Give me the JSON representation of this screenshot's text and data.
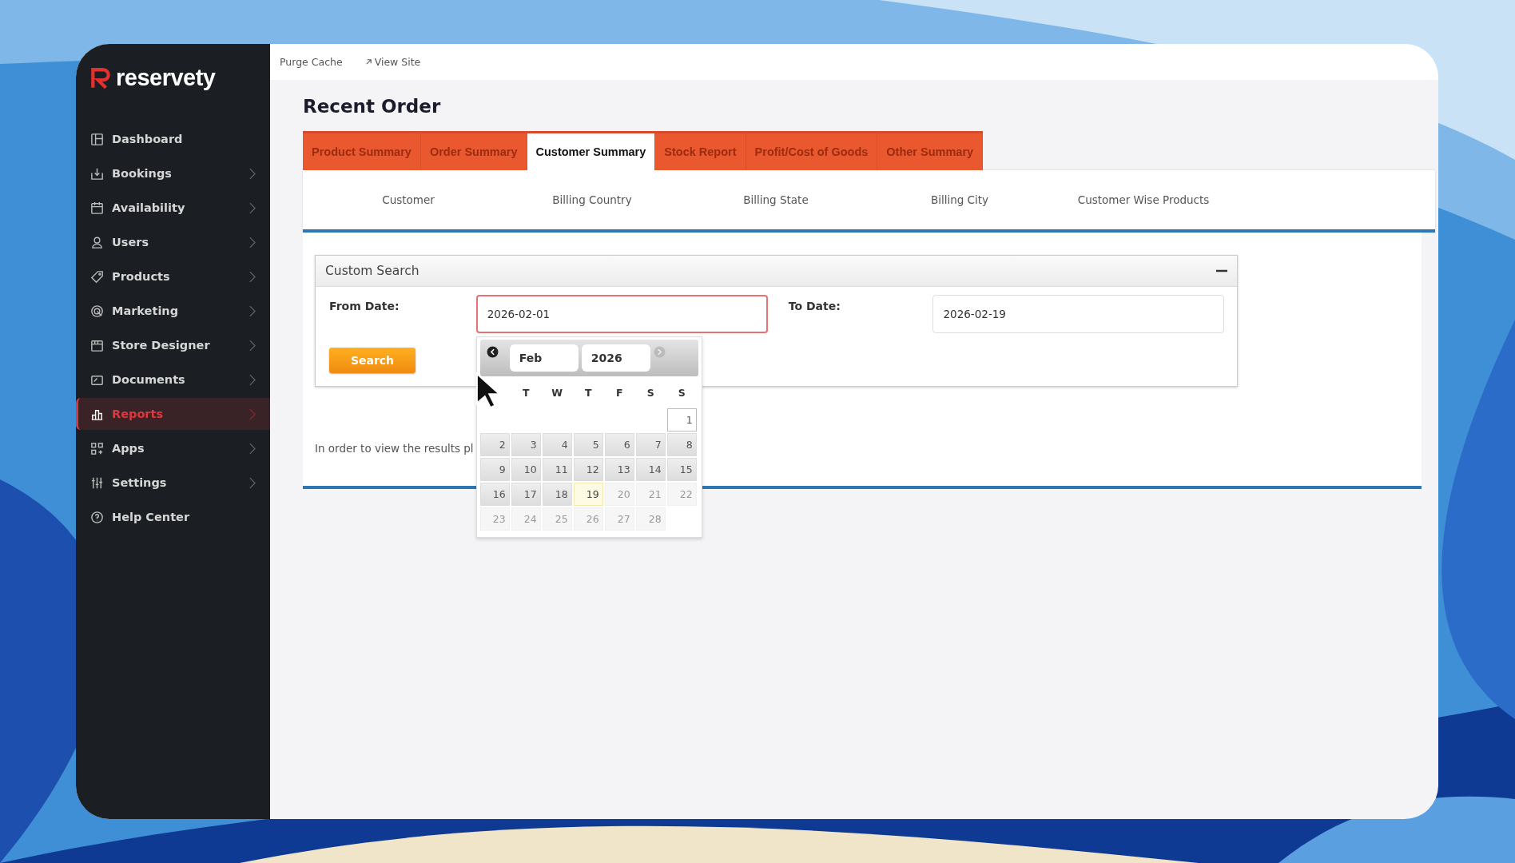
{
  "sidebar": {
    "logo": "reservety",
    "items": [
      {
        "label": "Dashboard",
        "selected": false,
        "expandable": false
      },
      {
        "label": "Bookings",
        "selected": false,
        "expandable": true
      },
      {
        "label": "Availability",
        "selected": false,
        "expandable": true
      },
      {
        "label": "Users",
        "selected": false,
        "expandable": true
      },
      {
        "label": "Products",
        "selected": false,
        "expandable": true
      },
      {
        "label": "Marketing",
        "selected": false,
        "expandable": true
      },
      {
        "label": "Store Designer",
        "selected": false,
        "expandable": true
      },
      {
        "label": "Documents",
        "selected": false,
        "expandable": true
      },
      {
        "label": "Reports",
        "selected": true,
        "expandable": true
      },
      {
        "label": "Apps",
        "selected": false,
        "expandable": true
      },
      {
        "label": "Settings",
        "selected": false,
        "expandable": true
      },
      {
        "label": "Help Center",
        "selected": false,
        "expandable": false
      }
    ]
  },
  "topbar": {
    "links": [
      {
        "label": "Purge Cache",
        "external": false
      },
      {
        "label": "View Site",
        "external": true
      }
    ]
  },
  "page_title": "Recent Order",
  "tabs": [
    {
      "label": "Product Summary",
      "selected": false
    },
    {
      "label": "Order Summary",
      "selected": false
    },
    {
      "label": "Customer Summary",
      "selected": true
    },
    {
      "label": "Stock Report",
      "selected": false
    },
    {
      "label": "Profit/Cost of Goods",
      "selected": false
    },
    {
      "label": "Other Summary",
      "selected": false
    }
  ],
  "subtabs": [
    "Customer",
    "Billing Country",
    "Billing State",
    "Billing City",
    "Customer Wise Products"
  ],
  "custom_search": {
    "title": "Custom Search",
    "expanded": true,
    "from": {
      "label": "From Date:",
      "value": "2026-02-01",
      "focused": true
    },
    "to": {
      "label": "To Date:",
      "value": "2026-02-19",
      "focused": false
    },
    "button": "Search"
  },
  "note": "In order to view the results pl",
  "calendar": {
    "month": "Feb",
    "year": "2026",
    "prev": {
      "disabled": false
    },
    "next": {
      "disabled": true
    },
    "weekdays": [
      "T",
      "W",
      "T",
      "F",
      "S",
      "S"
    ],
    "weeks": [
      [
        {
          "day": "1",
          "selected": true,
          "today": false,
          "disabled": false
        }
      ],
      [
        {
          "day": "2",
          "selected": false,
          "today": false,
          "disabled": false
        },
        {
          "day": "3",
          "selected": false,
          "today": false,
          "disabled": false
        },
        {
          "day": "4",
          "selected": false,
          "today": false,
          "disabled": false
        },
        {
          "day": "5",
          "selected": false,
          "today": false,
          "disabled": false
        },
        {
          "day": "6",
          "selected": false,
          "today": false,
          "disabled": false
        },
        {
          "day": "7",
          "selected": false,
          "today": false,
          "disabled": false
        },
        {
          "day": "8",
          "selected": false,
          "today": false,
          "disabled": false
        }
      ],
      [
        {
          "day": "9",
          "selected": false,
          "today": false,
          "disabled": false
        },
        {
          "day": "10",
          "selected": false,
          "today": false,
          "disabled": false
        },
        {
          "day": "11",
          "selected": false,
          "today": false,
          "disabled": false
        },
        {
          "day": "12",
          "selected": false,
          "today": false,
          "disabled": false
        },
        {
          "day": "13",
          "selected": false,
          "today": false,
          "disabled": false
        },
        {
          "day": "14",
          "selected": false,
          "today": false,
          "disabled": false
        },
        {
          "day": "15",
          "selected": false,
          "today": false,
          "disabled": false
        }
      ],
      [
        {
          "day": "16",
          "selected": false,
          "today": false,
          "disabled": false
        },
        {
          "day": "17",
          "selected": false,
          "today": false,
          "disabled": false
        },
        {
          "day": "18",
          "selected": false,
          "today": false,
          "disabled": false
        },
        {
          "day": "19",
          "selected": false,
          "today": true,
          "disabled": false
        },
        {
          "day": "20",
          "selected": false,
          "today": false,
          "disabled": true
        },
        {
          "day": "21",
          "selected": false,
          "today": false,
          "disabled": true
        },
        {
          "day": "22",
          "selected": false,
          "today": false,
          "disabled": true
        }
      ],
      [
        {
          "day": "23",
          "selected": false,
          "today": false,
          "disabled": true
        },
        {
          "day": "24",
          "selected": false,
          "today": false,
          "disabled": true
        },
        {
          "day": "25",
          "selected": false,
          "today": false,
          "disabled": true
        },
        {
          "day": "26",
          "selected": false,
          "today": false,
          "disabled": true
        },
        {
          "day": "27",
          "selected": false,
          "today": false,
          "disabled": true
        },
        {
          "day": "28",
          "selected": false,
          "today": false,
          "disabled": true
        }
      ]
    ]
  }
}
